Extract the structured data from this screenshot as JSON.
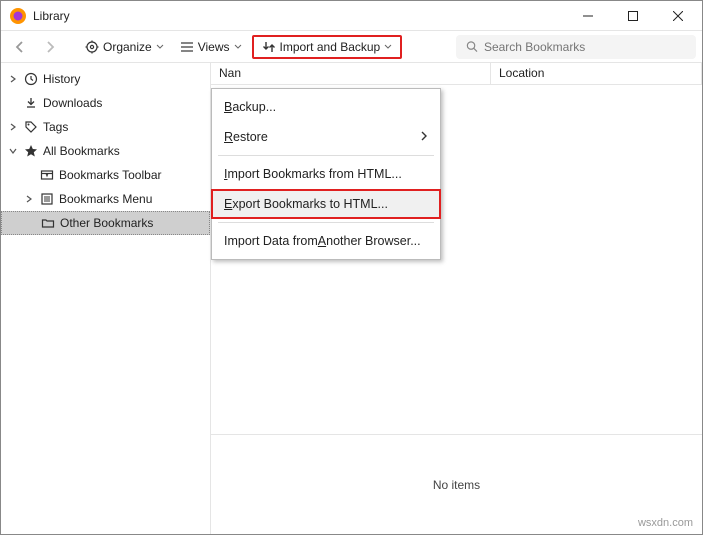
{
  "title": "Library",
  "toolbar": {
    "organize": "Organize",
    "views": "Views",
    "import_backup": "Import and Backup",
    "search_placeholder": "Search Bookmarks"
  },
  "sidebar": {
    "history": "History",
    "downloads": "Downloads",
    "tags": "Tags",
    "all_bookmarks": "All Bookmarks",
    "toolbar": "Bookmarks Toolbar",
    "menu": "Bookmarks Menu",
    "other": "Other Bookmarks"
  },
  "columns": {
    "name": "Nan",
    "location": "Location"
  },
  "menu": {
    "backup_pre": "",
    "backup_ul": "B",
    "backup_post": "ackup...",
    "restore_pre": "",
    "restore_ul": "R",
    "restore_post": "estore",
    "import_html_pre": "",
    "import_html_ul": "I",
    "import_html_post": "mport Bookmarks from HTML...",
    "export_html_pre": "",
    "export_html_ul": "E",
    "export_html_post": "xport Bookmarks to HTML...",
    "import_other_pre": "Import Data from ",
    "import_other_ul": "A",
    "import_other_post": "nother Browser..."
  },
  "status": "No items",
  "watermark": "wsxdn.com"
}
